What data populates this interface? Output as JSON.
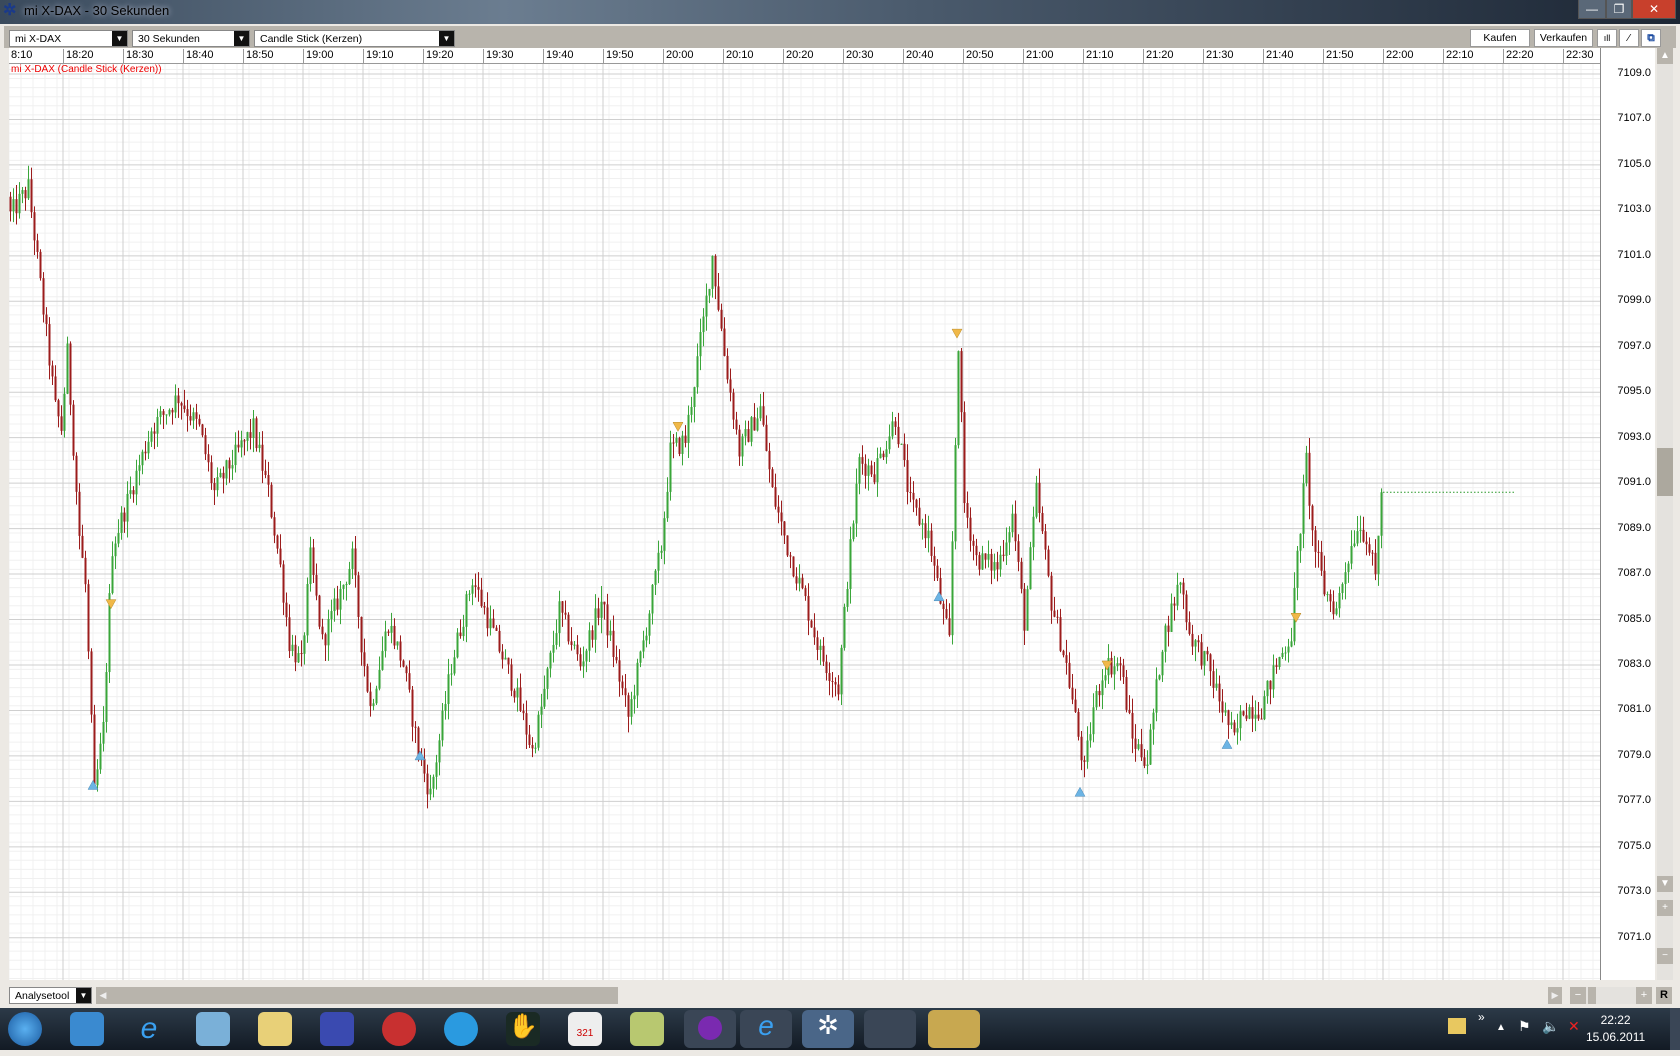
{
  "window": {
    "title": "mi X-DAX - 30 Sekunden",
    "minimize": "—",
    "maximize": "❐",
    "close": "✕"
  },
  "toolbar": {
    "instrument": "mi X-DAX",
    "interval": "30 Sekunden",
    "chart_type": "Candle Stick (Kerzen)",
    "buy": "Kaufen",
    "sell": "Verkaufen"
  },
  "chart_caption": "mi X-DAX (Candle Stick (Kerzen))",
  "bottom": {
    "analysis_tool": "Analysetool",
    "reset": "R",
    "zoom_minus": "−",
    "zoom_plus": "+"
  },
  "taskbar": {
    "time": "22:22",
    "date": "15.06.2011"
  },
  "colors": {
    "up": "#3aa63a",
    "down": "#9c1c1c",
    "buy_signal": "#6cb4e4",
    "sell_signal": "#f0b848",
    "last_price_line": "#2a9a2a"
  },
  "chart_data": {
    "type": "candlestick",
    "title": "mi X-DAX (Candle Stick (Kerzen))",
    "interval_seconds": 30,
    "x_range": [
      "18:10",
      "22:35"
    ],
    "ylim": [
      7069,
      7110
    ],
    "x_ticks": [
      "8:10",
      "18:20",
      "18:30",
      "18:40",
      "18:50",
      "19:00",
      "19:10",
      "19:20",
      "19:30",
      "19:40",
      "19:50",
      "20:00",
      "20:10",
      "20:20",
      "20:30",
      "20:40",
      "20:50",
      "21:00",
      "21:10",
      "21:20",
      "21:30",
      "21:40",
      "21:50",
      "22:00",
      "22:10",
      "22:20",
      "22:30"
    ],
    "y_ticks": [
      "7109.0",
      "7107.0",
      "7105.0",
      "7103.0",
      "7101.0",
      "7099.0",
      "7097.0",
      "7095.0",
      "7093.0",
      "7091.0",
      "7089.0",
      "7087.0",
      "7085.0",
      "7083.0",
      "7081.0",
      "7079.0",
      "7077.0",
      "7075.0",
      "7073.0",
      "7071.0"
    ],
    "price_path": [
      [
        "18:11:00",
        7102.8
      ],
      [
        "18:14:00",
        7104
      ],
      [
        "18:15:00",
        7101.9
      ],
      [
        "18:16:30",
        7098.6
      ],
      [
        "18:18:30",
        7094.3
      ],
      [
        "18:19:30",
        7093.4
      ],
      [
        "18:20:30",
        7096.7
      ],
      [
        "18:22:30",
        7088.7
      ],
      [
        "18:23:30",
        7086.5
      ],
      [
        "18:25:00",
        7077.3
      ],
      [
        "18:26:30",
        7080.2
      ],
      [
        "18:27:30",
        7085.8
      ],
      [
        "18:28:00",
        7088.2
      ],
      [
        "18:31:00",
        7090.6
      ],
      [
        "18:34:30",
        7093.4
      ],
      [
        "18:39:00",
        7094.8
      ],
      [
        "18:42:30",
        7093.4
      ],
      [
        "18:45:00",
        7090.6
      ],
      [
        "18:48:00",
        7092
      ],
      [
        "18:51:30",
        7093.4
      ],
      [
        "18:54:00",
        7090.6
      ],
      [
        "18:56:00",
        7087.3
      ],
      [
        "18:57:30",
        7084
      ],
      [
        "18:59:30",
        7083
      ],
      [
        "19:01:00",
        7087.7
      ],
      [
        "19:03:00",
        7084
      ],
      [
        "19:05:30",
        7085.8
      ],
      [
        "19:08:00",
        7087.7
      ],
      [
        "19:09:30",
        7084
      ],
      [
        "19:11:00",
        7081.1
      ],
      [
        "19:14:00",
        7084.9
      ],
      [
        "19:16:30",
        7083
      ],
      [
        "19:19:00",
        7079.2
      ],
      [
        "19:21:00",
        7077.3
      ],
      [
        "19:22:30",
        7079.7
      ],
      [
        "19:24:30",
        7083
      ],
      [
        "19:28:00",
        7086.8
      ],
      [
        "19:31:30",
        7084.4
      ],
      [
        "19:35:00",
        7082
      ],
      [
        "19:38:00",
        7079.2
      ],
      [
        "19:39:30",
        7081.1
      ],
      [
        "19:42:30",
        7085.4
      ],
      [
        "19:46:00",
        7083
      ],
      [
        "19:49:30",
        7085.8
      ],
      [
        "19:52:00",
        7083
      ],
      [
        "19:54:00",
        7080.7
      ],
      [
        "19:56:30",
        7084
      ],
      [
        "19:59:30",
        7088.2
      ],
      [
        "20:01:00",
        7092.4
      ],
      [
        "20:03:30",
        7092.9
      ],
      [
        "20:06:30",
        7098.1
      ],
      [
        "20:08:00",
        7101
      ],
      [
        "20:10:00",
        7096.7
      ],
      [
        "20:12:30",
        7092.4
      ],
      [
        "20:16:00",
        7094.3
      ],
      [
        "20:18:00",
        7090.6
      ],
      [
        "20:20:30",
        7088.2
      ],
      [
        "20:23:30",
        7085.8
      ],
      [
        "20:26:00",
        7083.5
      ],
      [
        "20:29:00",
        7082
      ],
      [
        "20:30:30",
        7086.8
      ],
      [
        "20:32:30",
        7092
      ],
      [
        "20:35:00",
        7091.5
      ],
      [
        "20:38:30",
        7093.9
      ],
      [
        "20:41:00",
        7090.1
      ],
      [
        "20:44:00",
        7088.7
      ],
      [
        "20:46:00",
        7085.8
      ],
      [
        "20:47:30",
        7084
      ],
      [
        "20:49:00",
        7097.2
      ],
      [
        "20:50:00",
        7090.1
      ],
      [
        "20:52:00",
        7087.7
      ],
      [
        "20:55:30",
        7087.3
      ],
      [
        "20:58:00",
        7089.6
      ],
      [
        "21:00:00",
        7084.9
      ],
      [
        "21:02:00",
        7090.6
      ],
      [
        "21:04:30",
        7085.8
      ],
      [
        "21:07:00",
        7083
      ],
      [
        "21:10:00",
        7078.3
      ],
      [
        "21:11:30",
        7081.1
      ],
      [
        "21:13:30",
        7083
      ],
      [
        "21:16:00",
        7083
      ],
      [
        "21:18:00",
        7079.7
      ],
      [
        "21:20:30",
        7078.8
      ],
      [
        "21:23:00",
        7084
      ],
      [
        "21:26:00",
        7086.8
      ],
      [
        "21:27:30",
        7084.4
      ],
      [
        "21:30:30",
        7083
      ],
      [
        "21:33:00",
        7081.1
      ],
      [
        "21:35:00",
        7079.7
      ],
      [
        "21:36:30",
        7081.1
      ],
      [
        "21:39:30",
        7081.1
      ],
      [
        "21:42:00",
        7083
      ],
      [
        "21:44:30",
        7084.4
      ],
      [
        "21:45:30",
        7087.7
      ],
      [
        "21:47:00",
        7092
      ],
      [
        "21:48:00",
        7088.7
      ],
      [
        "21:50:00",
        7086.3
      ],
      [
        "21:52:00",
        7085.4
      ],
      [
        "21:53:30",
        7087.3
      ],
      [
        "21:55:30",
        7089.2
      ],
      [
        "21:57:00",
        7088.7
      ],
      [
        "21:58:30",
        7086.8
      ],
      [
        "21:59:30",
        7090.6
      ]
    ],
    "buy_signals": [
      [
        "18:25:00",
        7077.7
      ],
      [
        "19:19:30",
        7079
      ],
      [
        "20:46:00",
        7086
      ],
      [
        "21:09:30",
        7077.4
      ],
      [
        "21:34:00",
        7079.5
      ]
    ],
    "sell_signals": [
      [
        "18:28:00",
        7085.7
      ],
      [
        "20:02:30",
        7093.5
      ],
      [
        "20:49:00",
        7097.6
      ],
      [
        "21:14:00",
        7083
      ],
      [
        "21:45:30",
        7085.1
      ]
    ],
    "last_price": {
      "value": 7090.6,
      "from": "22:00:00",
      "to": "22:22:00"
    }
  }
}
